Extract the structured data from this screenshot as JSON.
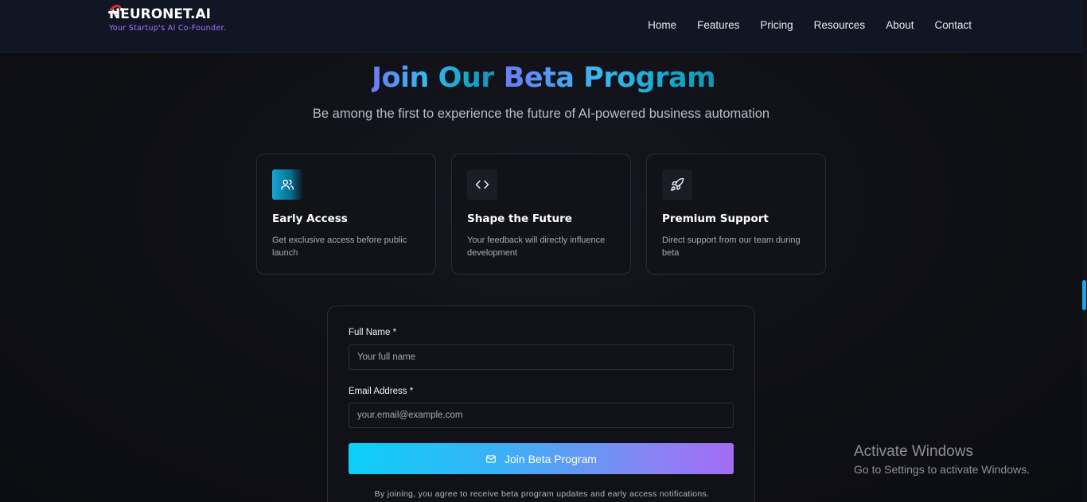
{
  "brand": {
    "name": "NEURONET.AI",
    "tagline": "Your Startup's AI Co-Founder."
  },
  "nav": {
    "items": [
      "Home",
      "Features",
      "Pricing",
      "Resources",
      "About",
      "Contact"
    ]
  },
  "hero": {
    "title_part1": "Join Our",
    "title_part2": "Beta Program",
    "subtitle": "Be among the first to experience the future of AI-powered business automation"
  },
  "cards": [
    {
      "icon": "users-icon",
      "title": "Early Access",
      "description": "Get exclusive access before public launch"
    },
    {
      "icon": "code-icon",
      "title": "Shape the Future",
      "description": "Your feedback will directly influence development"
    },
    {
      "icon": "rocket-icon",
      "title": "Premium Support",
      "description": "Direct support from our team during beta"
    }
  ],
  "form": {
    "name_label": "Full Name *",
    "name_placeholder": "Your full name",
    "email_label": "Email Address *",
    "email_placeholder": "your.email@example.com",
    "submit_label": "Join Beta Program",
    "consent": "By joining, you agree to receive beta program updates and early access notifications."
  },
  "watermark": {
    "title": "Activate Windows",
    "subtitle": "Go to Settings to activate Windows."
  },
  "colors": {
    "accent_cyan": "#0bd0f7",
    "accent_purple": "#a36cf3",
    "tagline_purple": "#a873ff",
    "nav_bg": "#111624"
  }
}
